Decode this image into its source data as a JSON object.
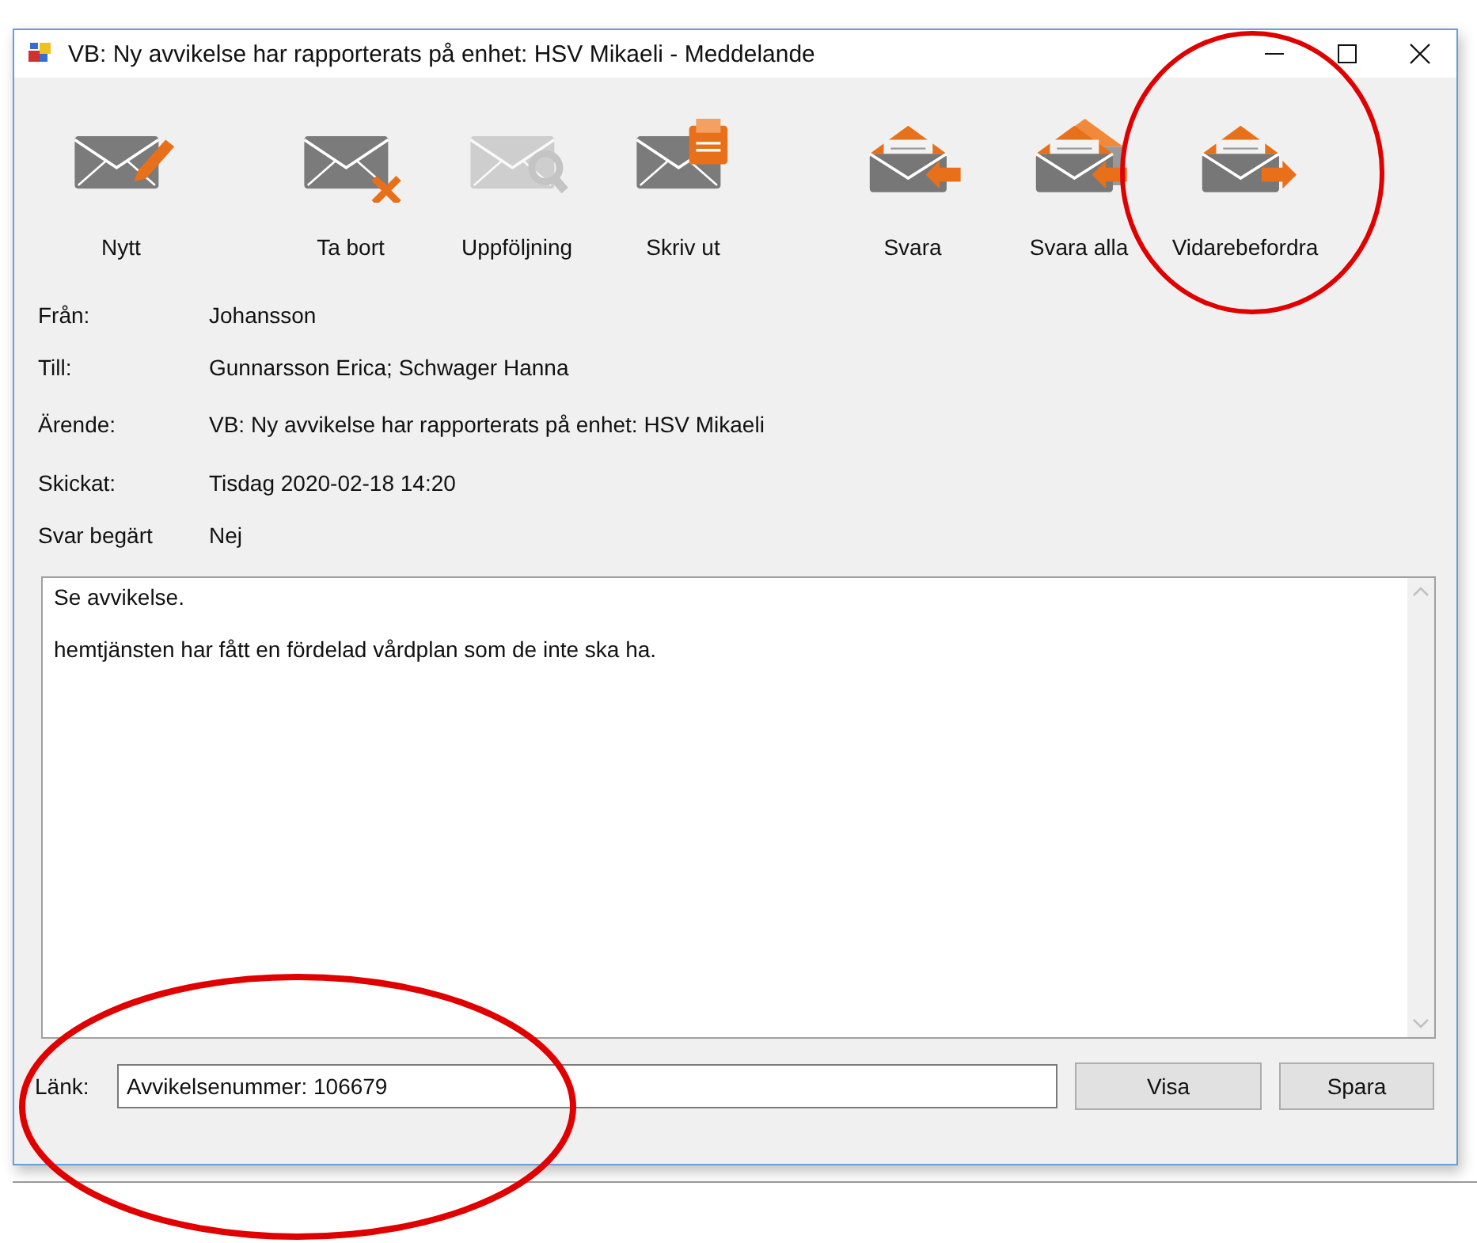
{
  "window": {
    "title": "VB: Ny avvikelse har rapporterats på enhet: HSV Mikaeli - Meddelande"
  },
  "toolbar": [
    [
      {
        "kind": "new",
        "label": "Nytt",
        "disabled": false
      }
    ],
    [
      {
        "kind": "delete",
        "label": "Ta bort",
        "disabled": false
      },
      {
        "kind": "followup",
        "label": "Uppföljning",
        "disabled": true
      },
      {
        "kind": "print",
        "label": "Skriv ut",
        "disabled": false
      }
    ],
    [
      {
        "kind": "reply",
        "label": "Svara",
        "disabled": false
      },
      {
        "kind": "reply_all",
        "label": "Svara alla",
        "disabled": false
      },
      {
        "kind": "forward",
        "label": "Vidarebefordra",
        "disabled": false
      }
    ]
  ],
  "fields": [
    {
      "label": "Från:",
      "value": "Johansson"
    },
    {
      "label": "Till:",
      "value": "Gunnarsson Erica; Schwager Hanna"
    },
    {
      "label": "Ärende:",
      "value": "VB: Ny avvikelse har rapporterats på enhet: HSV Mikaeli"
    },
    {
      "label": "Skickat:",
      "value": "Tisdag 2020-02-18 14:20"
    },
    {
      "label": "Svar begärt",
      "value": "Nej"
    }
  ],
  "body": [
    "Se avvikelse.",
    "hemtjänsten har fått en fördelad vårdplan som de inte ska ha."
  ],
  "link": {
    "label": "Länk:",
    "value": "Avvikelsenummer: 106679"
  },
  "buttons": [
    "Visa",
    "Spara"
  ]
}
